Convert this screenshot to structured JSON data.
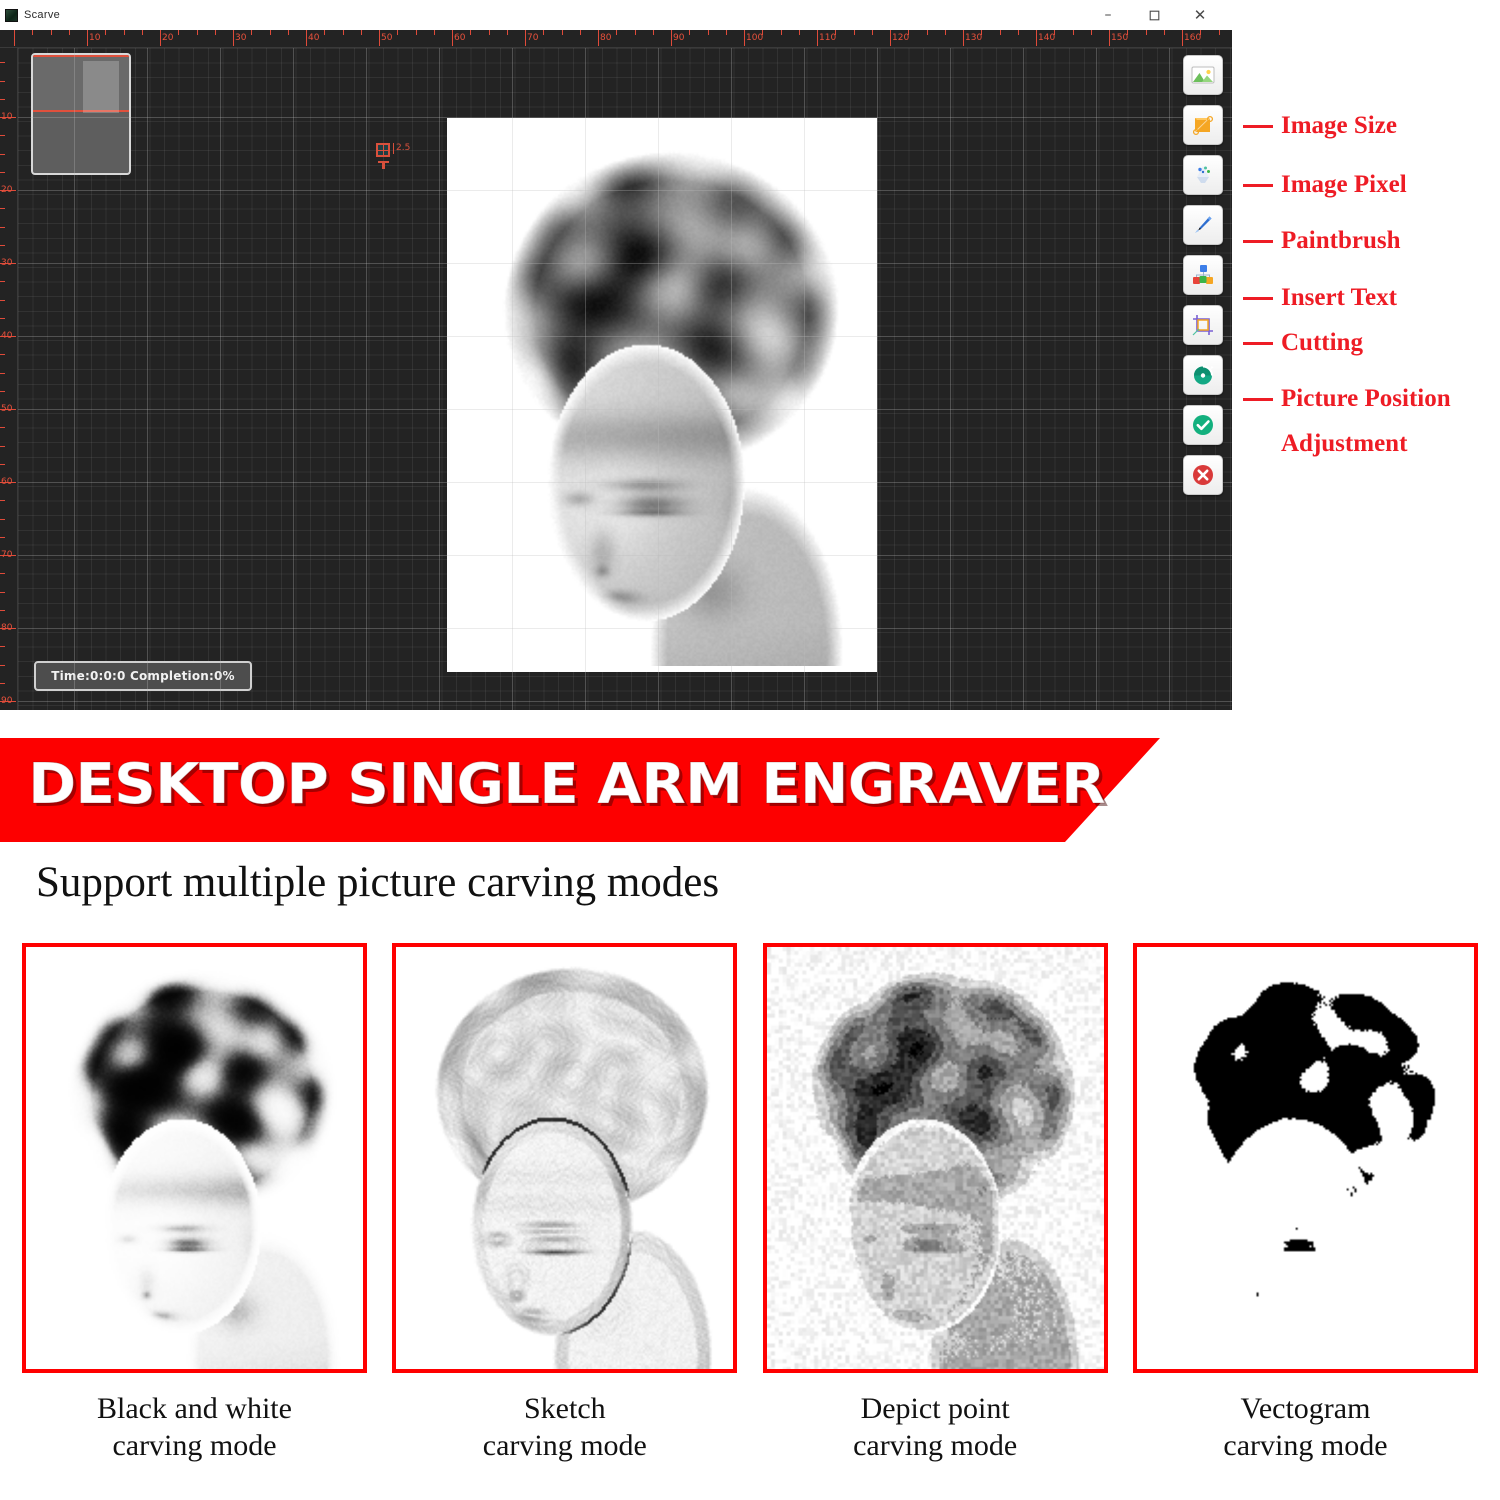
{
  "app": {
    "title": "Scarve",
    "logo_icon": "app-logo-icon",
    "window_controls": {
      "minimize": "–",
      "maximize": "❐",
      "close": "✕"
    },
    "ruler_horizontal": {
      "labels": [
        "10",
        "20",
        "30",
        "40",
        "50",
        "60",
        "70",
        "80",
        "90",
        "100",
        "110",
        "120",
        "130",
        "140",
        "150",
        "160"
      ],
      "unit_step": 10,
      "color": "#e8513c"
    },
    "ruler_vertical": {
      "labels": [
        "10",
        "20",
        "30",
        "40",
        "50",
        "60",
        "70",
        "80",
        "90"
      ],
      "unit_step": 10,
      "color": "#e8513c"
    },
    "grid_indicator": {
      "icon": "grid-four-squares-icon",
      "value": "2.5"
    },
    "status": {
      "text": "Time:0:0:0  Completion:0%",
      "time": "0:0:0",
      "completion": "0%"
    },
    "workspace_preview": {
      "name": "material-preview"
    },
    "canvas": {
      "background_color": "#232323",
      "grid_line_color": "#969696"
    },
    "toolbar": {
      "buttons": [
        {
          "icon": "image-landscape-icon",
          "label": "Load Image"
        },
        {
          "icon": "image-size-icon",
          "label": "Image Size"
        },
        {
          "icon": "image-pixel-icon",
          "label": "Image Pixel"
        },
        {
          "icon": "paintbrush-icon",
          "label": "Paintbrush"
        },
        {
          "icon": "insert-text-icon",
          "label": "Insert Text"
        },
        {
          "icon": "cutting-crop-icon",
          "label": "Cutting"
        },
        {
          "icon": "picture-position-icon",
          "label": "Picture Position Adjustment"
        },
        {
          "icon": "confirm-check-icon",
          "label": "Confirm"
        },
        {
          "icon": "cancel-cross-icon",
          "label": "Cancel"
        }
      ]
    }
  },
  "annotations": {
    "color": "#ee1c25",
    "items": [
      {
        "label": "Image Size",
        "target": "image-size-icon"
      },
      {
        "label": "Image Pixel",
        "target": "image-pixel-icon"
      },
      {
        "label": "Paintbrush",
        "target": "paintbrush-icon"
      },
      {
        "label": "Insert Text",
        "target": "insert-text-icon"
      },
      {
        "label": "Cutting",
        "target": "cutting-crop-icon"
      },
      {
        "label": "Picture Position",
        "target": "picture-position-icon"
      }
    ],
    "wrap_line": "Adjustment"
  },
  "banner": {
    "text": "DESKTOP SINGLE ARM ENGRAVER",
    "background_color": "#fd0000",
    "text_color": "#ffffff"
  },
  "subtitle": {
    "text": "Support multiple picture carving modes"
  },
  "modes": {
    "border_color": "#ff0000",
    "cards": [
      {
        "caption_line1": "Black and white",
        "caption_line2": "carving mode",
        "render": "bw"
      },
      {
        "caption_line1": "Sketch",
        "caption_line2": "carving mode",
        "render": "sketch"
      },
      {
        "caption_line1": "Depict point",
        "caption_line2": "carving mode",
        "render": "dither"
      },
      {
        "caption_line1": "Vectogram",
        "caption_line2": "carving mode",
        "render": "vector"
      }
    ]
  }
}
